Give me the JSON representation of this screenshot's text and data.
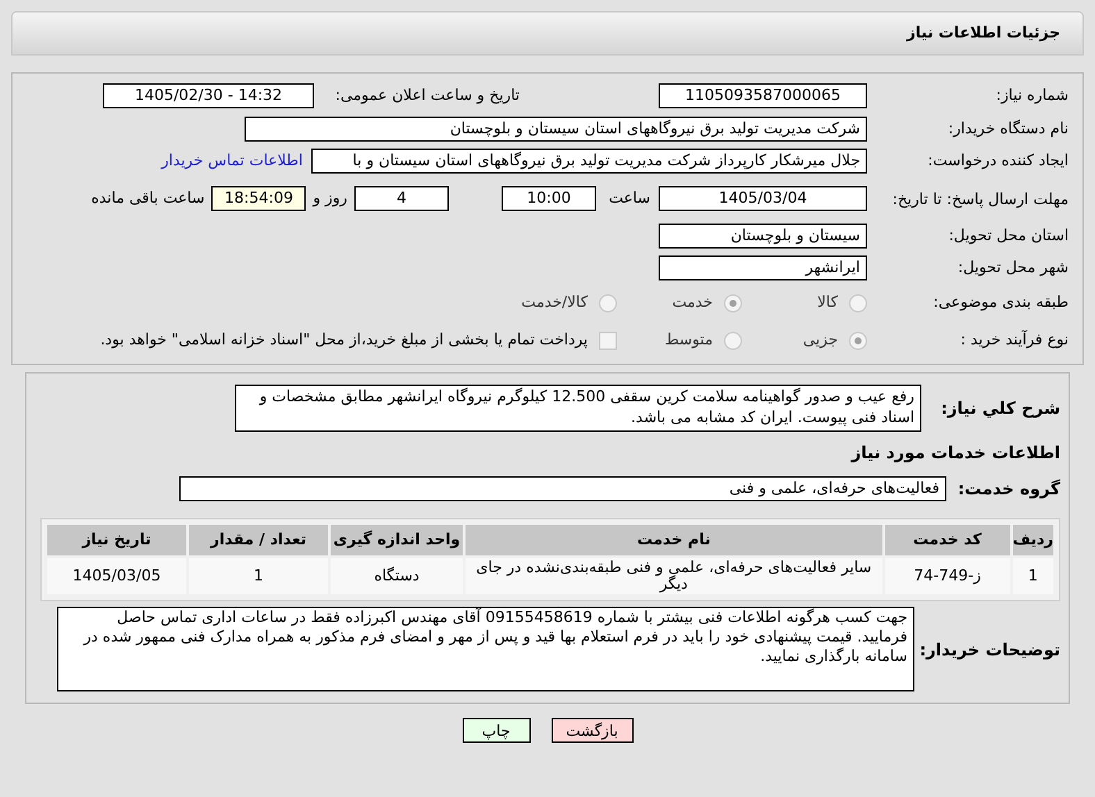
{
  "header": {
    "title": "جزئیات اطلاعات نیاز"
  },
  "need_number": {
    "label": "شماره نیاز:",
    "value": "1105093587000065"
  },
  "announce": {
    "label": "تاریخ و ساعت اعلان عمومی:",
    "value": "1405/02/30 - 14:32"
  },
  "buyer": {
    "label": "نام دستگاه خریدار:",
    "value": "شرکت مدیریت تولید برق نیروگاههای استان سیستان و بلوچستان"
  },
  "creator": {
    "label": "ایجاد کننده درخواست:",
    "value": "جلال میرشکار کارپرداز شرکت مدیریت تولید برق نیروگاههای استان سیستان و با",
    "link": "اطلاعات تماس خریدار"
  },
  "deadline": {
    "label": "مهلت ارسال پاسخ: تا تاریخ:",
    "date": "1405/03/04",
    "time_label": "ساعت",
    "time": "10:00",
    "days": "4",
    "days_label": "روز و",
    "remaining": "18:54:09",
    "remaining_label": "ساعت باقی مانده"
  },
  "province": {
    "label": "استان محل تحویل:",
    "value": "سیستان و بلوچستان"
  },
  "city": {
    "label": "شهر محل تحویل:",
    "value": "ایرانشهر"
  },
  "category": {
    "label": "طبقه بندی موضوعی:",
    "options": [
      {
        "label": "کالا",
        "selected": false
      },
      {
        "label": "خدمت",
        "selected": true
      },
      {
        "label": "کالا/خدمت",
        "selected": false
      }
    ]
  },
  "purchase_type": {
    "label": "نوع فرآیند خرید :",
    "options": [
      {
        "label": "جزیی",
        "selected": true
      },
      {
        "label": "متوسط",
        "selected": false
      }
    ],
    "payment": {
      "checked": false,
      "text": "پرداخت تمام یا بخشی از مبلغ خرید،از محل \"اسناد خزانه اسلامی\" خواهد بود."
    }
  },
  "description": {
    "label": "شرح کلي نياز:",
    "value": "رفع عیب و صدور گواهینامه سلامت کرین سقفی 12.500 کیلوگرم نیروگاه ایرانشهر مطابق مشخصات و اسناد فنی پیوست. ایران کد مشابه می باشد."
  },
  "services": {
    "title": "اطلاعات خدمات مورد نیاز",
    "group_label": "گروه خدمت:",
    "group_value": "فعالیت‌های حرفه‌ای، علمی و فنی"
  },
  "table": {
    "columns": [
      "ردیف",
      "کد خدمت",
      "نام خدمت",
      "واحد اندازه گیری",
      "تعداد / مقدار",
      "تاریخ نیاز"
    ],
    "rows": [
      [
        "1",
        "ز-749-74",
        "سایر فعالیت‌های حرفه‌ای، علمی و فنی طبقه‌بندی‌نشده در جای دیگر",
        "دستگاه",
        "1",
        "1405/03/05"
      ]
    ]
  },
  "notes": {
    "label": "توضیحات خریدار:",
    "value": "جهت کسب هرگونه اطلاعات فنی بیشتر با شماره 09155458619 آقای مهندس اکبرزاده فقط در ساعات اداری تماس حاصل فرمایید. قیمت پیشنهادی خود را باید در فرم استعلام بها قید و پس از مهر و امضای فرم مذکور به همراه مدارک فنی ممهور شده در سامانه بارگذاری نمایید."
  },
  "buttons": [
    {
      "kind": "return",
      "label": "بازگشت"
    },
    {
      "kind": "print",
      "label": "چاپ"
    }
  ]
}
